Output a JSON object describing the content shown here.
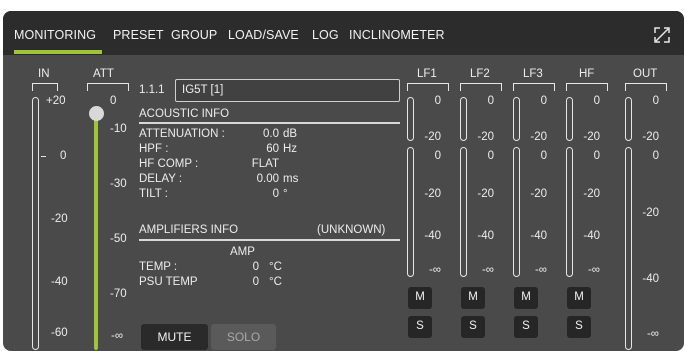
{
  "tabs": [
    {
      "label": "MONITORING"
    },
    {
      "label": "PRESET"
    },
    {
      "label": "GROUP"
    },
    {
      "label": "LOAD/SAVE"
    },
    {
      "label": "LOG"
    },
    {
      "label": "INCLINOMETER"
    }
  ],
  "active_tab": "MONITORING",
  "accent_color": "#9ec43a",
  "input_meter": {
    "header": "IN",
    "scale": [
      "+20",
      "0",
      "-20",
      "-40",
      "-60"
    ]
  },
  "attenuation": {
    "header": "ATT",
    "scale": [
      "0",
      "-10",
      "-30",
      "-50",
      "-70",
      "-∞"
    ],
    "slider_value_db": 0
  },
  "device": {
    "id": "1.1.1",
    "name": "IG5T [1]"
  },
  "acoustic": {
    "title": "ACOUSTIC INFO",
    "rows": [
      {
        "label": "ATTENUATION :",
        "value": "0.0",
        "unit": "dB"
      },
      {
        "label": "HPF :",
        "value": "60",
        "unit": "Hz"
      },
      {
        "label": "HF COMP :",
        "value": "FLAT",
        "unit": ""
      },
      {
        "label": "DELAY :",
        "value": "0.00",
        "unit": "ms"
      },
      {
        "label": "TILT :",
        "value": "0",
        "unit": "°"
      }
    ]
  },
  "amplifiers": {
    "title": "AMPLIFIERS INFO",
    "status": "(UNKNOWN)",
    "column": "AMP",
    "rows": [
      {
        "label": "TEMP :",
        "value": "0",
        "unit": "°C"
      },
      {
        "label": "PSU TEMP",
        "value": "0",
        "unit": "°C"
      }
    ]
  },
  "buttons": {
    "mute": "MUTE",
    "solo": "SOLO",
    "m": "M",
    "s": "S"
  },
  "bands": [
    {
      "name": "LF1",
      "gr_label": "0",
      "scale": [
        "-20",
        "0",
        "-20",
        "-40",
        "-∞"
      ]
    },
    {
      "name": "LF2",
      "gr_label": "0",
      "scale": [
        "-20",
        "0",
        "-20",
        "-40",
        "-∞"
      ]
    },
    {
      "name": "LF3",
      "gr_label": "0",
      "scale": [
        "-20",
        "0",
        "-20",
        "-40",
        "-∞"
      ]
    },
    {
      "name": "HF",
      "gr_label": "0",
      "scale": [
        "-20",
        "0",
        "-20",
        "-40",
        "-∞"
      ]
    }
  ],
  "output": {
    "header": "OUT",
    "gr_label": "0",
    "scale": [
      "-20",
      "0",
      "-20",
      "-40",
      "-∞"
    ]
  }
}
